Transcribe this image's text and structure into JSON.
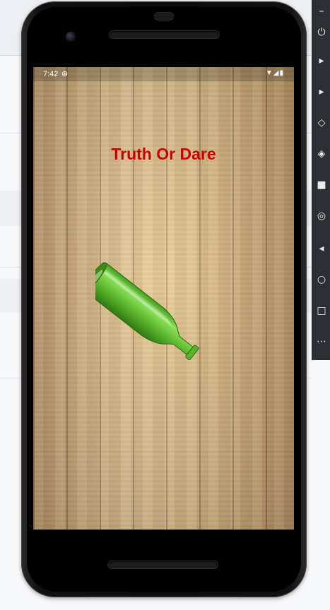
{
  "status_bar": {
    "time": "7:42"
  },
  "app": {
    "title": "Truth Or Dare"
  },
  "colors": {
    "title": "#cc0000",
    "bottle": "#6fc23a"
  },
  "icons": {
    "status_data": "data-saver-icon",
    "status_wifi": "wifi-icon",
    "status_signal": "signal-icon",
    "status_battery": "battery-icon",
    "bottle": "bottle-icon"
  }
}
